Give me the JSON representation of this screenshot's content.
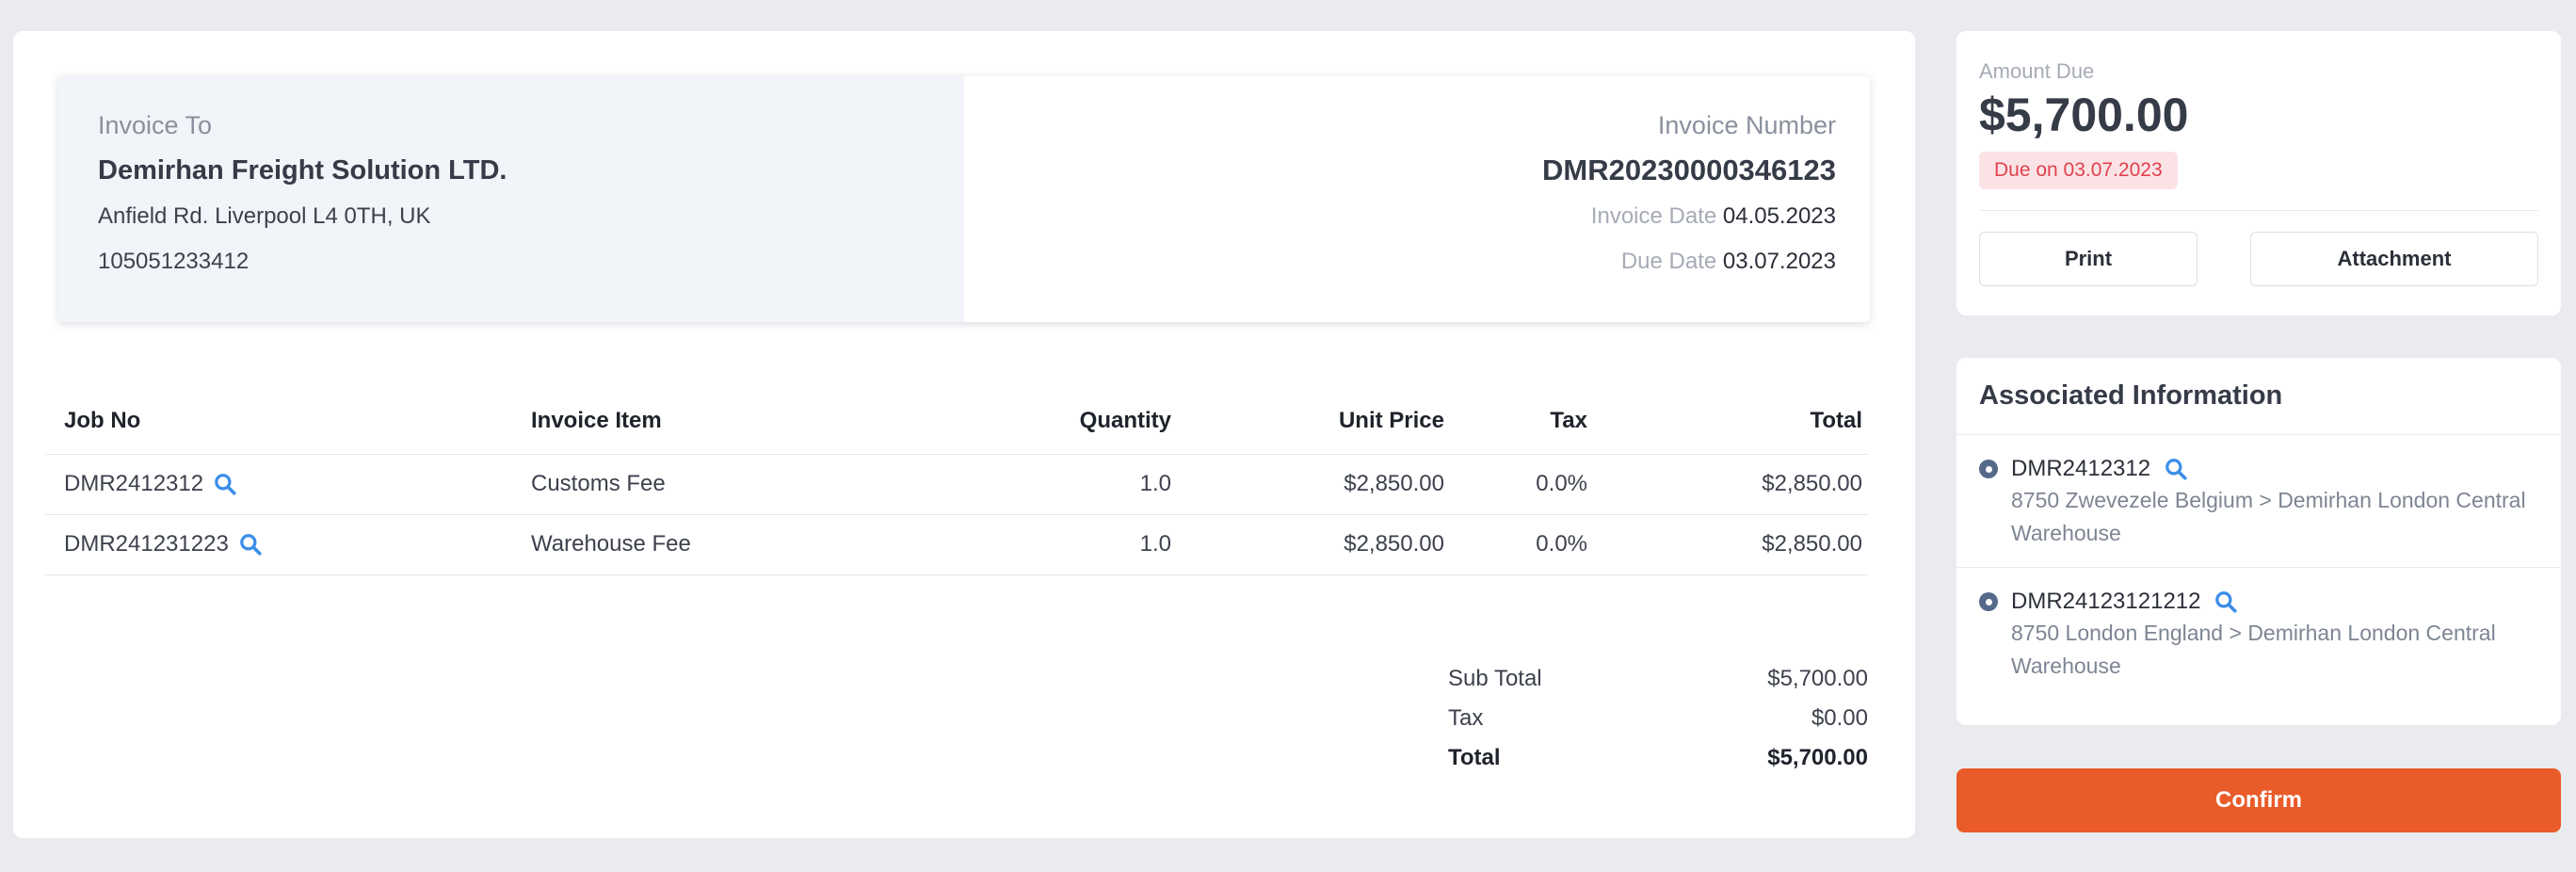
{
  "invoice": {
    "to_label": "Invoice To",
    "company": "Demirhan Freight Solution LTD.",
    "address": "Anfield Rd. Liverpool L4 0TH, UK",
    "tax_number": "105051233412",
    "number_label": "Invoice Number",
    "number": "DMR20230000346123",
    "date_label": "Invoice Date",
    "date": "04.05.2023",
    "due_label": "Due Date",
    "due_date": "03.07.2023"
  },
  "table": {
    "headers": {
      "job_no": "Job No",
      "item": "Invoice Item",
      "quantity": "Quantity",
      "unit_price": "Unit Price",
      "tax": "Tax",
      "total": "Total"
    },
    "rows": [
      {
        "job_no": "DMR2412312",
        "item": "Customs Fee",
        "quantity": "1.0",
        "unit_price": "$2,850.00",
        "tax": "0.0%",
        "total": "$2,850.00"
      },
      {
        "job_no": "DMR241231223",
        "item": "Warehouse Fee",
        "quantity": "1.0",
        "unit_price": "$2,850.00",
        "tax": "0.0%",
        "total": "$2,850.00"
      }
    ]
  },
  "totals": {
    "subtotal_label": "Sub Total",
    "subtotal": "$5,700.00",
    "tax_label": "Tax",
    "tax": "$0.00",
    "total_label": "Total",
    "total": "$5,700.00"
  },
  "summary": {
    "amount_label": "Amount Due",
    "amount": "$5,700.00",
    "due_badge": "Due on 03.07.2023",
    "print_label": "Print",
    "attachment_label": "Attachment"
  },
  "associated": {
    "title": "Associated Information",
    "items": [
      {
        "job_no": "DMR2412312",
        "route": "8750 Zwevezele Belgium > Demirhan London Central Warehouse"
      },
      {
        "job_no": "DMR24123121212",
        "route": "8750 London England > Demirhan London Central Warehouse"
      }
    ]
  },
  "confirm_label": "Confirm",
  "colors": {
    "accent": "#ea5b2a",
    "search_icon": "#3b8ee8",
    "due_badge_bg": "#fbe3e5",
    "due_badge_text": "#e0404f",
    "radio": "#55698a"
  }
}
